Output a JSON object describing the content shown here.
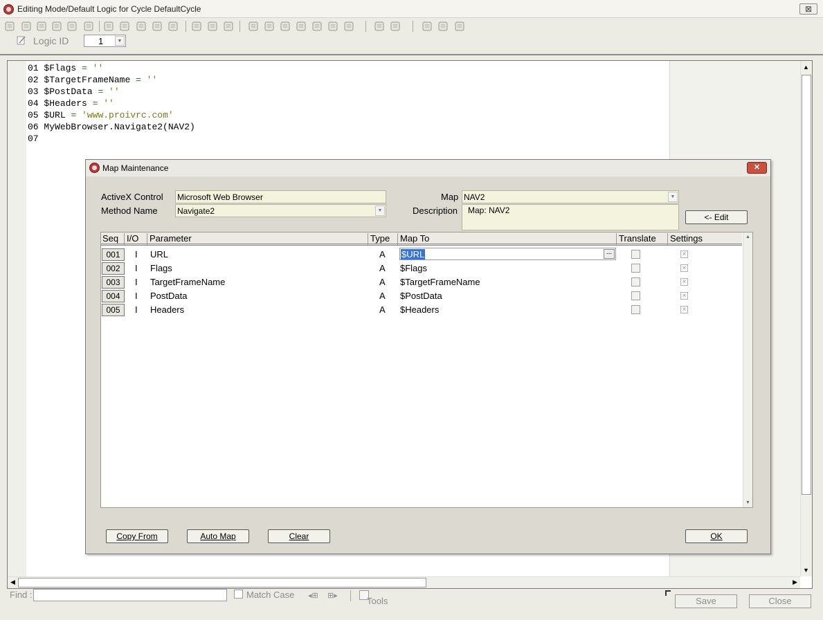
{
  "window": {
    "title": "Editing Mode/Default Logic for Cycle DefaultCycle",
    "close_glyph": "⊠"
  },
  "logic": {
    "label": "Logic ID",
    "value": "1"
  },
  "code_lines": [
    {
      "num": "01",
      "var": "$Flags",
      "op": " = ",
      "str": "''"
    },
    {
      "num": "02",
      "var": "$TargetFrameName",
      "op": " = ",
      "str": "''"
    },
    {
      "num": "03",
      "var": "$PostData",
      "op": " = ",
      "str": "''"
    },
    {
      "num": "04",
      "var": "$Headers",
      "op": " = ",
      "str": "''"
    },
    {
      "num": "05",
      "var": "$URL",
      "op": " = ",
      "str": "'www.proivrc.com'"
    },
    {
      "num": "06",
      "var": "MyWebBrowser.Navigate2(NAV2)",
      "op": "",
      "str": ""
    },
    {
      "num": "07",
      "var": "",
      "op": "",
      "str": ""
    }
  ],
  "findbar": {
    "find_label": "Find :",
    "find_value": "",
    "match_case_label": "Match Case",
    "tools_label": "Tools",
    "save_label": "Save",
    "close_label": "Close"
  },
  "dialog": {
    "title": "Map Maintenance",
    "close_glyph": "✕",
    "activex_label": "ActiveX Control",
    "activex_value": "Microsoft Web Browser",
    "method_label": "Method Name",
    "method_value": "Navigate2",
    "map_label": "Map",
    "map_value": "NAV2",
    "description_label": "Description",
    "description_value": "Map: NAV2",
    "edit_button": "<- Edit",
    "columns": [
      "Seq",
      "I/O",
      "Parameter",
      "Type",
      "Map To",
      "Translate",
      "Settings"
    ],
    "rows": [
      {
        "seq": "001",
        "io": "I",
        "param": "URL",
        "type": "A",
        "mapto": "$URL",
        "translate": false,
        "settings": true
      },
      {
        "seq": "002",
        "io": "I",
        "param": "Flags",
        "type": "A",
        "mapto": "$Flags",
        "translate": false,
        "settings": true
      },
      {
        "seq": "003",
        "io": "I",
        "param": "TargetFrameName",
        "type": "A",
        "mapto": "$TargetFrameName",
        "translate": false,
        "settings": true
      },
      {
        "seq": "004",
        "io": "I",
        "param": "PostData",
        "type": "A",
        "mapto": "$PostData",
        "translate": false,
        "settings": true
      },
      {
        "seq": "005",
        "io": "I",
        "param": "Headers",
        "type": "A",
        "mapto": "$Headers",
        "translate": false,
        "settings": true
      }
    ],
    "copy_from": "Copy From",
    "auto_map": "Auto Map",
    "clear": "Clear",
    "ok": "OK"
  }
}
